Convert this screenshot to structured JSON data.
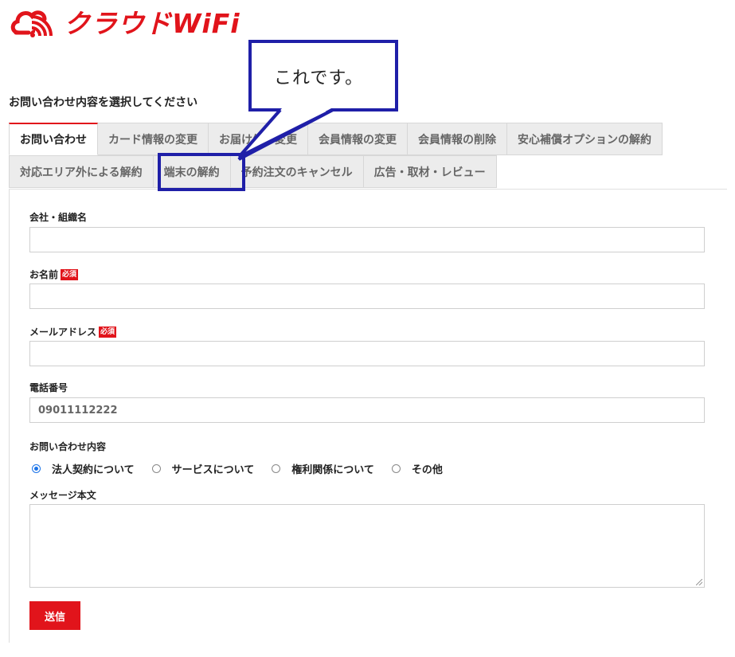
{
  "brand": {
    "name": "クラウドWiFi",
    "color": "#e1141b"
  },
  "heading": "お問い合わせ内容を選択してください",
  "tabs_row1": [
    "お問い合わせ",
    "カード情報の変更",
    "お届け先の変更",
    "会員情報の変更",
    "会員情報の削除",
    "安心補償オプションの解約"
  ],
  "tabs_row2": [
    "対応エリア外による解約",
    "端末の解約",
    "予約注文のキャンセル",
    "広告・取材・レビュー"
  ],
  "active_tab": "お問い合わせ",
  "form": {
    "company_label": "会社・組織名",
    "company_value": "",
    "name_label": "お名前",
    "name_value": "",
    "email_label": "メールアドレス",
    "email_value": "",
    "required_badge": "必須",
    "phone_label": "電話番号",
    "phone_value": "09011112222",
    "inquiry_label": "お問い合わせ内容",
    "inquiry_options": [
      "法人契約について",
      "サービスについて",
      "権利関係について",
      "その他"
    ],
    "inquiry_selected": "法人契約について",
    "message_label": "メッセージ本文",
    "message_value": "",
    "submit_label": "送信"
  },
  "annotation": {
    "callout_text": "これです。",
    "highlight_color": "#1f1fa8"
  }
}
